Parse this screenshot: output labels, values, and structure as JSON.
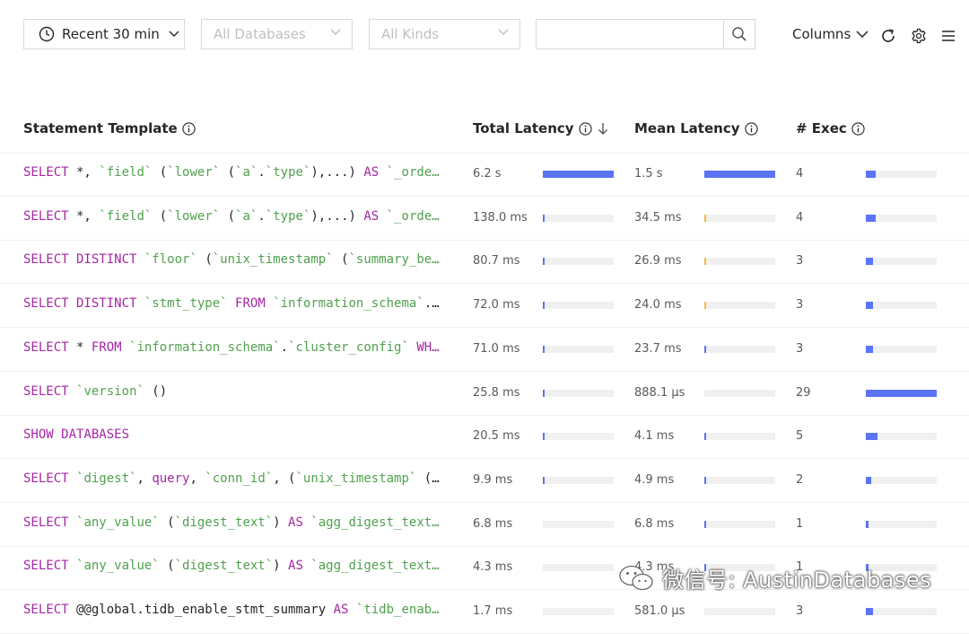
{
  "toolbar": {
    "time_range": "Recent 30 min",
    "database_placeholder": "All Databases",
    "kind_placeholder": "All Kinds",
    "search_value": "",
    "columns_label": "Columns"
  },
  "table": {
    "headers": {
      "statement": "Statement Template",
      "total_latency": "Total Latency",
      "mean_latency": "Mean Latency",
      "exec": "# Exec"
    },
    "rows": [
      {
        "tokens": [
          [
            "kw",
            "SELECT"
          ],
          [
            "p",
            " *, "
          ],
          [
            "id",
            "`field`"
          ],
          [
            "p",
            " ("
          ],
          [
            "id",
            "`lower`"
          ],
          [
            "p",
            " ("
          ],
          [
            "id",
            "`a`"
          ],
          [
            "p",
            "."
          ],
          [
            "id",
            "`type`"
          ],
          [
            "p",
            "),...) "
          ],
          [
            "kw",
            "AS"
          ],
          [
            "p",
            " "
          ],
          [
            "id",
            "`_orde…"
          ]
        ],
        "total": "6.2 s",
        "total_frac": 1.0,
        "total_color": "#5b73f5",
        "mean": "1.5 s",
        "mean_frac": 1.0,
        "mean_color": "#5b73f5",
        "exec": "4",
        "exec_frac": 0.14
      },
      {
        "tokens": [
          [
            "kw",
            "SELECT"
          ],
          [
            "p",
            " *, "
          ],
          [
            "id",
            "`field`"
          ],
          [
            "p",
            " ("
          ],
          [
            "id",
            "`lower`"
          ],
          [
            "p",
            " ("
          ],
          [
            "id",
            "`a`"
          ],
          [
            "p",
            "."
          ],
          [
            "id",
            "`type`"
          ],
          [
            "p",
            "),...) "
          ],
          [
            "kw",
            "AS"
          ],
          [
            "p",
            " "
          ],
          [
            "id",
            "`_orde…"
          ]
        ],
        "total": "138.0 ms",
        "total_frac": 0.02,
        "total_color": "#5b73f5",
        "mean": "34.5 ms",
        "mean_frac": 0.03,
        "mean_color": "#f5b740",
        "exec": "4",
        "exec_frac": 0.14
      },
      {
        "tokens": [
          [
            "kw",
            "SELECT DISTINCT"
          ],
          [
            "p",
            " "
          ],
          [
            "id",
            "`floor`"
          ],
          [
            "p",
            " ("
          ],
          [
            "id",
            "`unix_timestamp`"
          ],
          [
            "p",
            " ("
          ],
          [
            "id",
            "`summary_be…"
          ]
        ],
        "total": "80.7 ms",
        "total_frac": 0.015,
        "total_color": "#5b73f5",
        "mean": "26.9 ms",
        "mean_frac": 0.03,
        "mean_color": "#f5b740",
        "exec": "3",
        "exec_frac": 0.1
      },
      {
        "tokens": [
          [
            "kw",
            "SELECT DISTINCT"
          ],
          [
            "p",
            " "
          ],
          [
            "id",
            "`stmt_type`"
          ],
          [
            "p",
            " "
          ],
          [
            "kw",
            "FROM"
          ],
          [
            "p",
            " "
          ],
          [
            "id",
            "`information_schema`"
          ],
          [
            "p",
            ".…"
          ]
        ],
        "total": "72.0 ms",
        "total_frac": 0.012,
        "total_color": "#5b73f5",
        "mean": "24.0 ms",
        "mean_frac": 0.025,
        "mean_color": "#f5b740",
        "exec": "3",
        "exec_frac": 0.1
      },
      {
        "tokens": [
          [
            "kw",
            "SELECT"
          ],
          [
            "p",
            " * "
          ],
          [
            "kw",
            "FROM"
          ],
          [
            "p",
            " "
          ],
          [
            "id",
            "`information_schema`"
          ],
          [
            "p",
            "."
          ],
          [
            "id",
            "`cluster_config`"
          ],
          [
            "p",
            " "
          ],
          [
            "kw",
            "WH…"
          ]
        ],
        "total": "71.0 ms",
        "total_frac": 0.012,
        "total_color": "#5b73f5",
        "mean": "23.7 ms",
        "mean_frac": 0.02,
        "mean_color": "#5b73f5",
        "exec": "3",
        "exec_frac": 0.1
      },
      {
        "tokens": [
          [
            "kw",
            "SELECT"
          ],
          [
            "p",
            " "
          ],
          [
            "id",
            "`version`"
          ],
          [
            "p",
            " ()"
          ]
        ],
        "total": "25.8 ms",
        "total_frac": 0.01,
        "total_color": "#5b73f5",
        "mean": "888.1 µs",
        "mean_frac": 0.0,
        "mean_color": "#5b73f5",
        "exec": "29",
        "exec_frac": 1.0
      },
      {
        "tokens": [
          [
            "kw",
            "SHOW DATABASES"
          ]
        ],
        "total": "20.5 ms",
        "total_frac": 0.01,
        "total_color": "#5b73f5",
        "mean": "4.1 ms",
        "mean_frac": 0.01,
        "mean_color": "#5b73f5",
        "exec": "5",
        "exec_frac": 0.17
      },
      {
        "tokens": [
          [
            "kw",
            "SELECT"
          ],
          [
            "p",
            " "
          ],
          [
            "id",
            "`digest`"
          ],
          [
            "p",
            ", "
          ],
          [
            "kw",
            "query"
          ],
          [
            "p",
            ", "
          ],
          [
            "id",
            "`conn_id`"
          ],
          [
            "p",
            ", ("
          ],
          [
            "id",
            "`unix_timestamp`"
          ],
          [
            "p",
            " (…"
          ]
        ],
        "total": "9.9 ms",
        "total_frac": 0.005,
        "total_color": "#5b73f5",
        "mean": "4.9 ms",
        "mean_frac": 0.01,
        "mean_color": "#5b73f5",
        "exec": "2",
        "exec_frac": 0.07
      },
      {
        "tokens": [
          [
            "kw",
            "SELECT"
          ],
          [
            "p",
            " "
          ],
          [
            "id",
            "`any_value`"
          ],
          [
            "p",
            " ("
          ],
          [
            "id",
            "`digest_text`"
          ],
          [
            "p",
            ") "
          ],
          [
            "kw",
            "AS"
          ],
          [
            "p",
            " "
          ],
          [
            "id",
            "`agg_digest_text…"
          ]
        ],
        "total": "6.8 ms",
        "total_frac": 0.0,
        "total_color": "#5b73f5",
        "mean": "6.8 ms",
        "mean_frac": 0.01,
        "mean_color": "#5b73f5",
        "exec": "1",
        "exec_frac": 0.035
      },
      {
        "tokens": [
          [
            "kw",
            "SELECT"
          ],
          [
            "p",
            " "
          ],
          [
            "id",
            "`any_value`"
          ],
          [
            "p",
            " ("
          ],
          [
            "id",
            "`digest_text`"
          ],
          [
            "p",
            ") "
          ],
          [
            "kw",
            "AS"
          ],
          [
            "p",
            " "
          ],
          [
            "id",
            "`agg_digest_text…"
          ]
        ],
        "total": "4.3 ms",
        "total_frac": 0.0,
        "total_color": "#5b73f5",
        "mean": "4.3 ms",
        "mean_frac": 0.01,
        "mean_color": "#5b73f5",
        "exec": "1",
        "exec_frac": 0.035
      },
      {
        "tokens": [
          [
            "kw",
            "SELECT"
          ],
          [
            "p",
            " @@global.tidb_enable_stmt_summary "
          ],
          [
            "kw",
            "AS"
          ],
          [
            "p",
            " "
          ],
          [
            "id",
            "`tidb_enab…"
          ]
        ],
        "total": "1.7 ms",
        "total_frac": 0.0,
        "total_color": "#5b73f5",
        "mean": "581.0 µs",
        "mean_frac": 0.0,
        "mean_color": "#5b73f5",
        "exec": "3",
        "exec_frac": 0.1
      }
    ]
  },
  "watermark": "微信号: AustinDatabases"
}
